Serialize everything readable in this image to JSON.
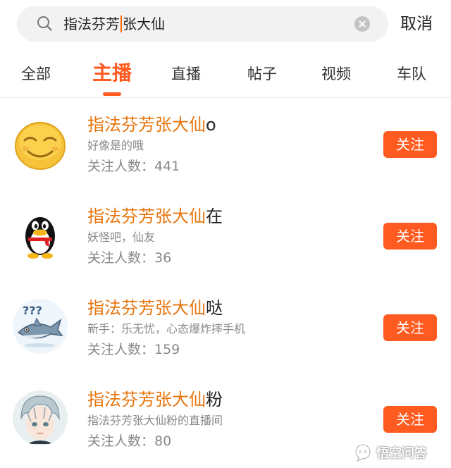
{
  "search": {
    "query_before_cursor": "指法芬芳",
    "query_after_cursor": "张大仙",
    "cancel_label": "取消"
  },
  "tabs": [
    {
      "label": "全部",
      "active": false
    },
    {
      "label": "主播",
      "active": true
    },
    {
      "label": "直播",
      "active": false
    },
    {
      "label": "帖子",
      "active": false
    },
    {
      "label": "视频",
      "active": false
    },
    {
      "label": "车队",
      "active": false
    }
  ],
  "results": [
    {
      "name_highlight": "指法芬芳张大仙",
      "name_suffix": "o",
      "description": "好像是的哦",
      "followers": "关注人数：441",
      "follow_label": "关注",
      "avatar": "smiley-emoji-avatar"
    },
    {
      "name_highlight": "指法芬芳张大仙",
      "name_suffix": "在",
      "description": "妖怪吧，仙友",
      "followers": "关注人数：36",
      "follow_label": "关注",
      "avatar": "penguin-avatar"
    },
    {
      "name_highlight": "指法芬芳张大仙",
      "name_suffix": "哒",
      "description": "新手：乐无忧，心态爆炸摔手机",
      "followers": "关注人数：159",
      "follow_label": "关注",
      "avatar": "shark-question-avatar"
    },
    {
      "name_highlight": "指法芬芳张大仙",
      "name_suffix": "粉",
      "description": "指法芬芳张大仙粉的直播间",
      "followers": "关注人数：80",
      "follow_label": "关注",
      "avatar": "anime-boy-avatar"
    }
  ],
  "watermark": {
    "text": "悟空问答"
  },
  "colors": {
    "accent": "#ff5a1f",
    "highlight_text": "#e8740c",
    "search_background": "#f2f2f2",
    "secondary_text": "#888888"
  }
}
